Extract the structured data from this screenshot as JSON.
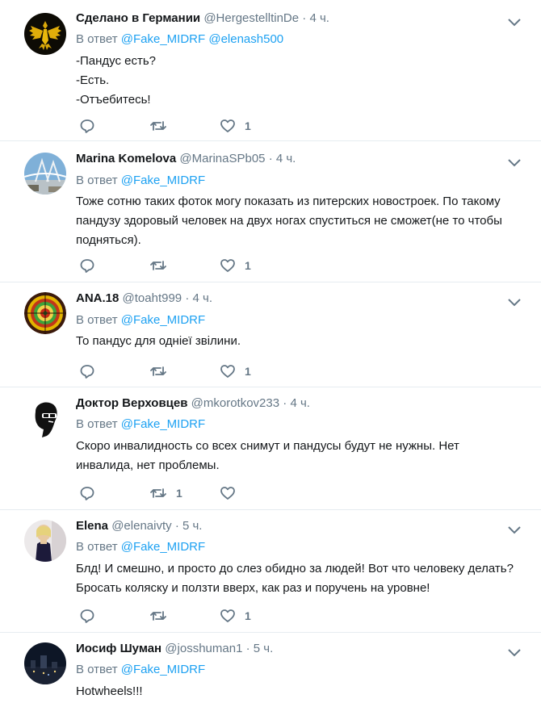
{
  "tweets": [
    {
      "name": "Сделано в Германии",
      "handle": "@HergestelltinDe",
      "time": "4 ч.",
      "reply_prefix": "В ответ",
      "reply_to": [
        "@Fake_MIDRF",
        "@elenash500"
      ],
      "body": [
        "-Пандус есть?",
        "-Есть.",
        "-Отъебитесь!"
      ],
      "retweets": "",
      "likes": "1",
      "avatar": "eagle-emblem"
    },
    {
      "name": "Marina Komelova",
      "handle": "@MarinaSPb05",
      "time": "4 ч.",
      "reply_prefix": "В ответ",
      "reply_to": [
        "@Fake_MIDRF"
      ],
      "body": [
        "Тоже сотню таких фоток могу показать из питерских новостроек. По такому",
        "пандузу здоровый человек на двух ногах спуститься не сможет(не то чтобы",
        "подняться)."
      ],
      "retweets": "",
      "likes": "1",
      "avatar": "bridge-photo"
    },
    {
      "name": "ANA.18",
      "handle": "@toaht999",
      "time": "4 ч.",
      "reply_prefix": "В ответ",
      "reply_to": [
        "@Fake_MIDRF"
      ],
      "body": [
        "То пандус для однiеї звiлини."
      ],
      "retweets": "",
      "likes": "1",
      "avatar": "colorful-pattern"
    },
    {
      "name": "Доктор Верховцев",
      "handle": "@mkorotkov233",
      "time": "4 ч.",
      "reply_prefix": "В ответ",
      "reply_to": [
        "@Fake_MIDRF"
      ],
      "body": [
        "Скоро инвалидность со всех снимут и пандусы будут не нужны. Нет",
        "инвалида, нет проблемы."
      ],
      "retweets": "1",
      "likes": "",
      "avatar": "sunglasses-face"
    },
    {
      "name": "Elena",
      "handle": "@elenaivty",
      "time": "5 ч.",
      "reply_prefix": "В ответ",
      "reply_to": [
        "@Fake_MIDRF"
      ],
      "body": [
        "Блд! И смешно, и просто до слез обидно за людей! Вот что человеку делать?",
        "Бросать коляску и ползти вверх, как раз и поручень на уровне!"
      ],
      "retweets": "",
      "likes": "1",
      "avatar": "woman-photo"
    },
    {
      "name": "Иосиф Шуман",
      "handle": "@josshuman1",
      "time": "5 ч.",
      "reply_prefix": "В ответ",
      "reply_to": [
        "@Fake_MIDRF"
      ],
      "body": [
        "Hotwheels!!!"
      ],
      "retweets": "",
      "likes": "",
      "avatar": "night-city-photo"
    }
  ],
  "colors": {
    "link": "#1da1f2",
    "muted": "#657786",
    "text": "#14171a",
    "divider": "#e6ecf0"
  }
}
